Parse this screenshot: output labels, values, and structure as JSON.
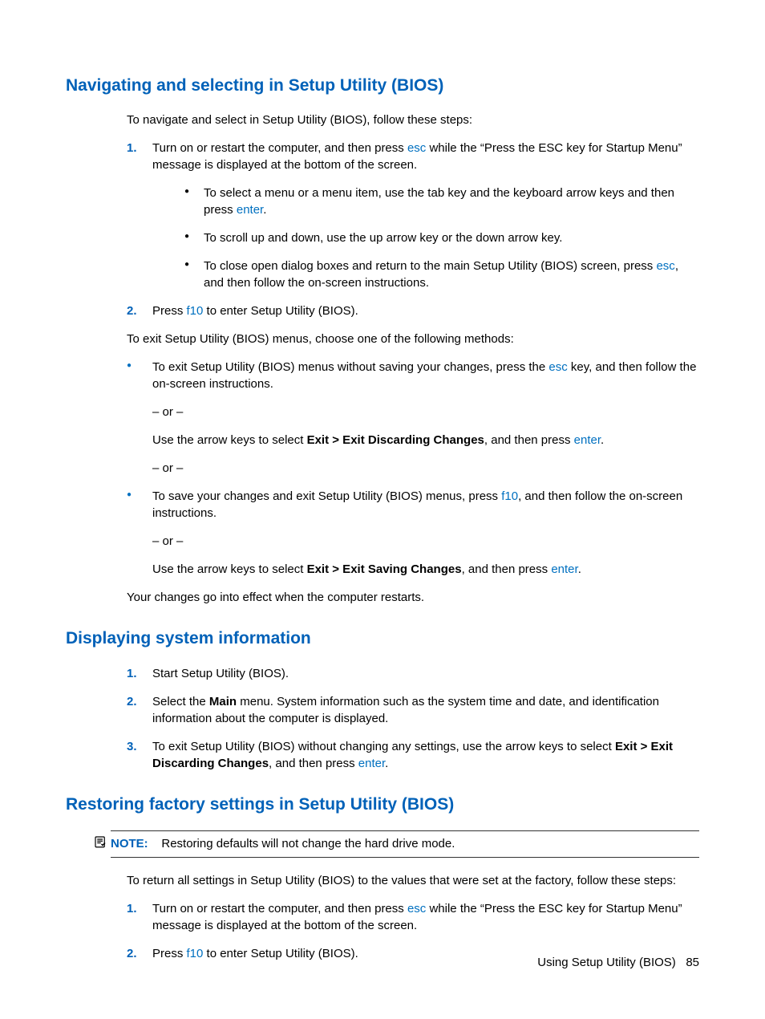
{
  "s1": {
    "heading": "Navigating and selecting in Setup Utility (BIOS)",
    "intro": "To navigate and select in Setup Utility (BIOS), follow these steps:",
    "n1": "1.",
    "li1a": "Turn on or restart the computer, and then press ",
    "li1key": "esc",
    "li1b": " while the “Press the ESC key for Startup Menu” message is displayed at the bottom of the screen.",
    "sub1a": "To select a menu or a menu item, use the tab key and the keyboard arrow keys and then press ",
    "sub1key": "enter",
    "sub1b": ".",
    "sub2": "To scroll up and down, use the up arrow key or the down arrow key.",
    "sub3a": "To close open dialog boxes and return to the main Setup Utility (BIOS) screen, press ",
    "sub3key": "esc",
    "sub3b": ", and then follow the on-screen instructions.",
    "n2": "2.",
    "li2a": "Press ",
    "li2key": "f10",
    "li2b": " to enter Setup Utility (BIOS).",
    "exit_intro": "To exit Setup Utility (BIOS) menus, choose one of the following methods:",
    "b1a": "To exit Setup Utility (BIOS) menus without saving your changes, press the ",
    "b1key": "esc",
    "b1b": " key, and then follow the on-screen instructions.",
    "or": "– or –",
    "b1c": "Use the arrow keys to select ",
    "b1bold": "Exit > Exit Discarding Changes",
    "b1d": ", and then press ",
    "b1key2": "enter",
    "b1e": ".",
    "b2a": "To save your changes and exit Setup Utility (BIOS) menus, press ",
    "b2key": "f10",
    "b2b": ", and then follow the on-screen instructions.",
    "b2c": "Use the arrow keys to select ",
    "b2bold": "Exit > Exit Saving Changes",
    "b2d": ", and then press ",
    "b2key2": "enter",
    "b2e": ".",
    "outro": "Your changes go into effect when the computer restarts."
  },
  "s2": {
    "heading": "Displaying system information",
    "n1": "1.",
    "li1": "Start Setup Utility (BIOS).",
    "n2": "2.",
    "li2a": "Select the ",
    "li2bold": "Main",
    "li2b": " menu. System information such as the system time and date, and identification information about the computer is displayed.",
    "n3": "3.",
    "li3a": "To exit Setup Utility (BIOS) without changing any settings, use the arrow keys to select ",
    "li3bold": "Exit > Exit Discarding Changes",
    "li3b": ", and then press ",
    "li3key": "enter",
    "li3c": "."
  },
  "s3": {
    "heading": "Restoring factory settings in Setup Utility (BIOS)",
    "note_label": "NOTE:",
    "note_text": "Restoring defaults will not change the hard drive mode.",
    "intro": "To return all settings in Setup Utility (BIOS) to the values that were set at the factory, follow these steps:",
    "n1": "1.",
    "li1a": "Turn on or restart the computer, and then press ",
    "li1key": "esc",
    "li1b": " while the “Press the ESC key for Startup Menu” message is displayed at the bottom of the screen.",
    "n2": "2.",
    "li2a": "Press ",
    "li2key": "f10",
    "li2b": " to enter Setup Utility (BIOS)."
  },
  "footer": {
    "text": "Using Setup Utility (BIOS)",
    "page": "85"
  }
}
